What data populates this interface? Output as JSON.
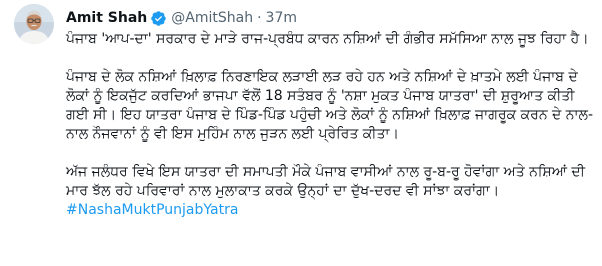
{
  "author": {
    "display_name": "Amit Shah",
    "handle": "@AmitShah",
    "separator": "·",
    "time_ago": "37m",
    "verified_icon": "verified-badge-icon",
    "verified_color": "#1d9bf0"
  },
  "tweet": {
    "paragraphs": [
      "ਪੰਜਾਬ 'ਆਪ-ਦਾ' ਸਰਕਾਰ ਦੇ ਮਾੜੇ ਰਾਜ-ਪ੍ਰਬੰਧ ਕਾਰਨ ਨਸ਼ਿਆਂ ਦੀ ਗੰਭੀਰ ਸਮੱਸਿਆ ਨਾਲ ਜੂਝ ਰਿਹਾ ਹੈ।",
      "ਪੰਜਾਬ ਦੇ ਲੋਕ ਨਸ਼ਿਆਂ ਖ਼ਿਲਾਫ਼ ਨਿਰਣਾਇਕ ਲੜਾਈ ਲੜ ਰਹੇ ਹਨ ਅਤੇ ਨਸ਼ਿਆਂ ਦੇ ਖ਼ਾਤਮੇ ਲਈ ਪੰਜਾਬ ਦੇ ਲੋਕਾਂ ਨੂੰ ਇਕਜੁੱਟ ਕਰਦਿਆਂ ਭਾਜਪਾ ਵੱਲੋਂ 18 ਸਤੰਬਰ ਨੂੰ 'ਨਸ਼ਾ ਮੁਕਤ ਪੰਜਾਬ ਯਾਤਰਾ' ਦੀ ਸ਼ੁਰੂਆਤ ਕੀਤੀ ਗਈ ਸੀ। ਇਹ ਯਾਤਰਾ ਪੰਜਾਬ ਦੇ ਪਿੰਡ-ਪਿੰਡ ਪਹੁੰਚੀ ਅਤੇ ਲੋਕਾਂ ਨੂੰ ਨਸ਼ਿਆਂ ਖ਼ਿਲਾਫ਼ ਜਾਗਰੂਕ ਕਰਨ ਦੇ ਨਾਲ-ਨਾਲ ਨੌਜਵਾਨਾਂ ਨੂੰ ਵੀ ਇਸ ਮੁਹਿੰਮ ਨਾਲ ਜੁੜਨ ਲਈ ਪ੍ਰੇਰਿਤ ਕੀਤਾ।",
      "ਅੱਜ ਜਲੰਧਰ ਵਿਖੇ ਇਸ ਯਾਤਰਾ ਦੀ ਸਮਾਪਤੀ ਮੌਕੇ ਪੰਜਾਬ ਵਾਸੀਆਂ ਨਾਲ ਰੂ-ਬ-ਰੂ ਹੋਵਾਂਗਾ ਅਤੇ ਨਸ਼ਿਆਂ ਦੀ ਮਾਰ ਝੱਲ ਰਹੇ ਪਰਿਵਾਰਾਂ ਨਾਲ ਮੁਲਾਕਾਤ ਕਰਕੇ ਉਨ੍ਹਾਂ ਦਾ ਦੁੱਖ-ਦਰਦ ਵੀ ਸਾਂਝਾ ਕਰਾਂਗਾ।"
    ],
    "hashtag": "#NashaMuktPunjabYatra",
    "hashtag_color": "#1d9bf0"
  },
  "avatar": {
    "icon": "profile-photo-avatar",
    "background": "#c9d6e2"
  }
}
